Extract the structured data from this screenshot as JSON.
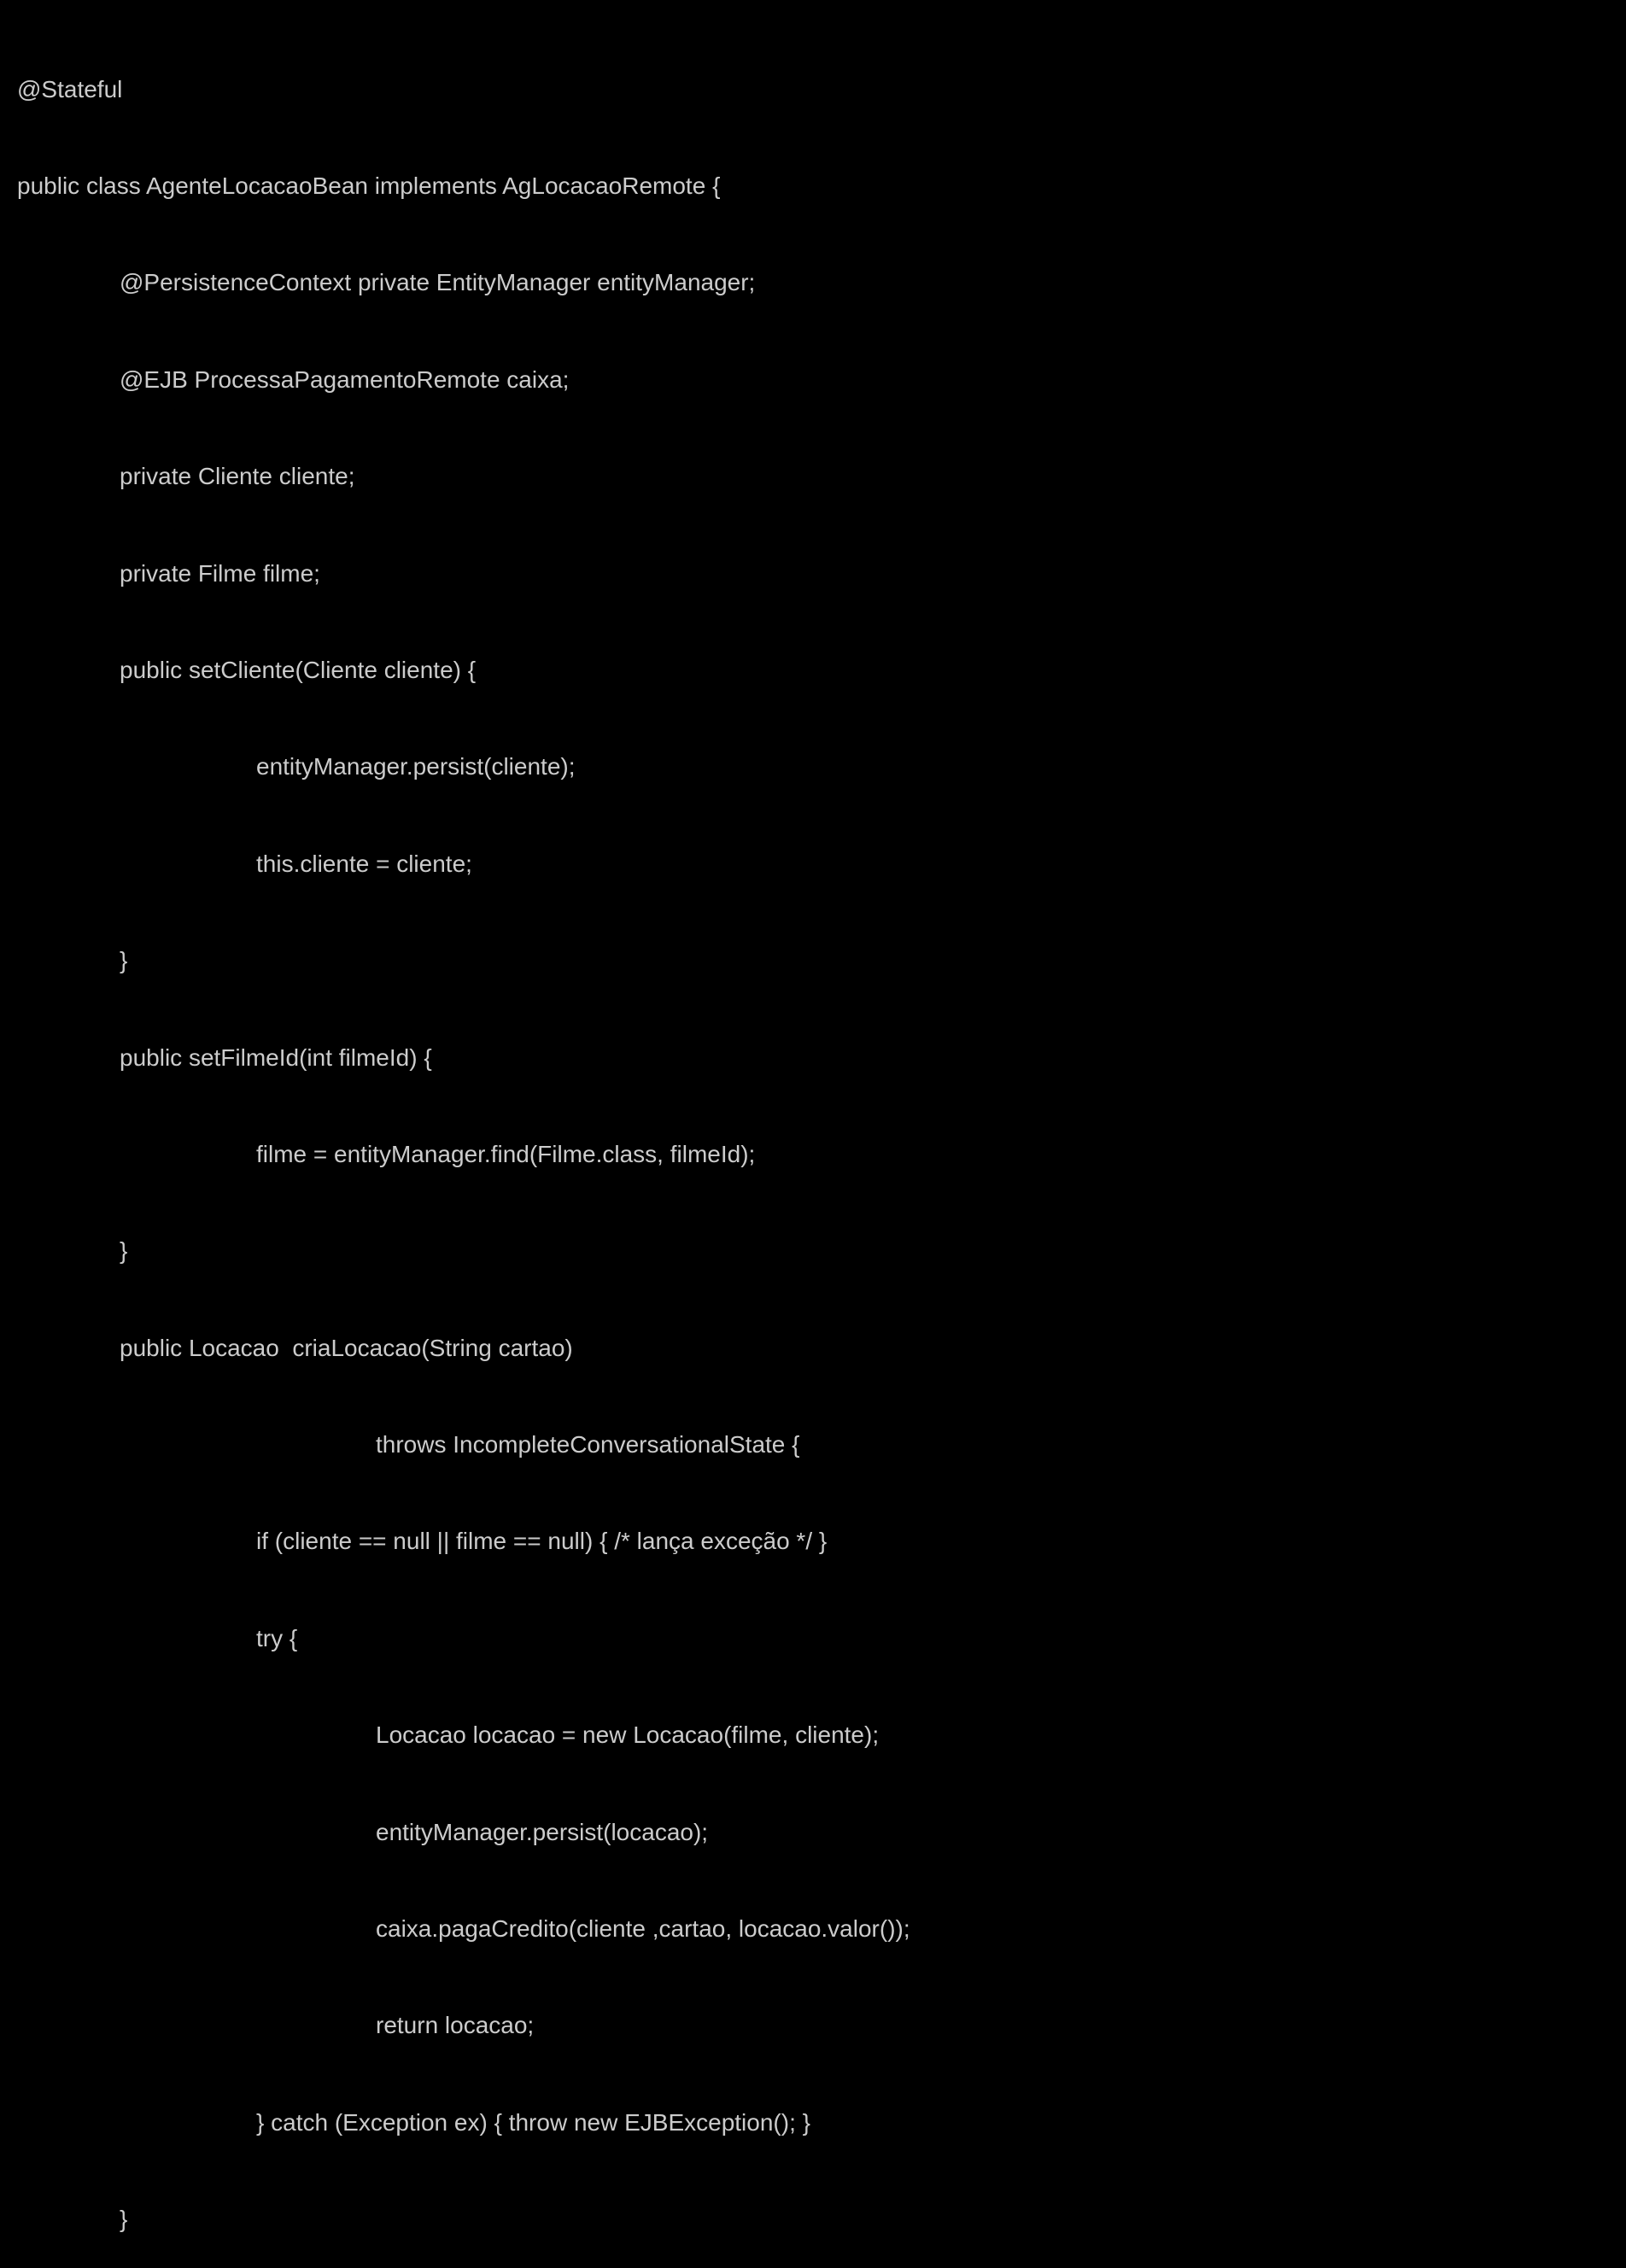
{
  "code": {
    "l1": "@Stateful",
    "l2": "public class AgenteLocacaoBean implements AgLocacaoRemote {",
    "l3": "@PersistenceContext private EntityManager entityManager;",
    "l4": "@EJB ProcessaPagamentoRemote caixa;",
    "l5": "private Cliente cliente;",
    "l6": "private Filme filme;",
    "l7": "public setCliente(Cliente cliente) {",
    "l8": "entityManager.persist(cliente);",
    "l9": "this.cliente = cliente;",
    "l10": "}",
    "l11": "public setFilmeId(int filmeId) {",
    "l12": "filme = entityManager.find(Filme.class, filmeId);",
    "l13": "}",
    "l14": "public Locacao  criaLocacao(String cartao)",
    "l15": "throws IncompleteConversationalState {",
    "l16": "if (cliente == null || filme == null) { /* lança exceção */ }",
    "l17": "try {",
    "l18": "Locacao locacao = new Locacao(filme, cliente);",
    "l19": "entityManager.persist(locacao);",
    "l20": "caixa.pagaCredito(cliente ,cartao, locacao.valor());",
    "l21": "return locacao;",
    "l22": "} catch (Exception ex) { throw new EJBException(); }",
    "l23": "}"
  }
}
